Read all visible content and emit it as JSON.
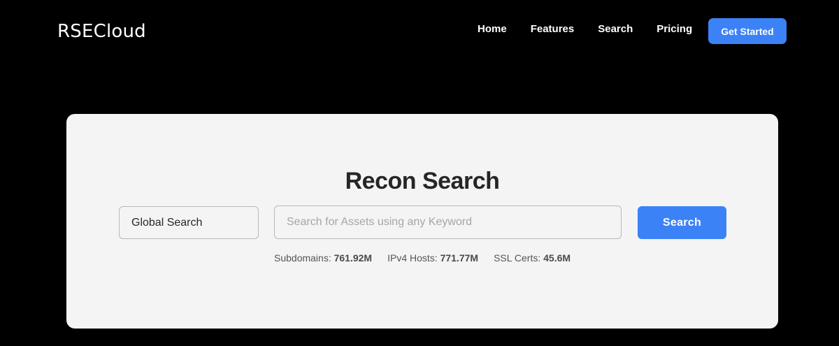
{
  "header": {
    "logo": "RSECloud",
    "nav": [
      {
        "label": "Home"
      },
      {
        "label": "Features"
      },
      {
        "label": "Search"
      },
      {
        "label": "Pricing"
      }
    ],
    "cta_label": "Get Started"
  },
  "search_card": {
    "title": "Recon Search",
    "scope_value": "Global Search",
    "input_value": "",
    "input_placeholder": "Search for Assets using any Keyword",
    "button_label": "Search",
    "stats": [
      {
        "label": "Subdomains:",
        "value": "761.92M"
      },
      {
        "label": "IPv4 Hosts:",
        "value": "771.77M"
      },
      {
        "label": "SSL Certs:",
        "value": "45.6M"
      }
    ]
  },
  "colors": {
    "background": "#000000",
    "accent": "#3b82f6",
    "card": "#f4f4f4",
    "title_text": "#262626"
  }
}
